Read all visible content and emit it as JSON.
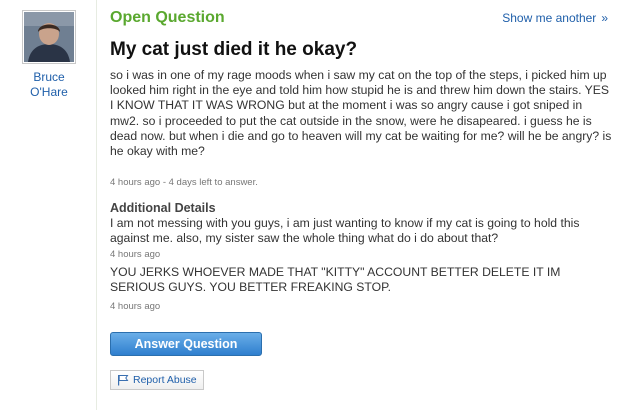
{
  "user": {
    "name_line1": "Bruce",
    "name_line2": "O'Hare"
  },
  "header": {
    "status": "Open Question",
    "show_another": "Show me another",
    "show_another_chevron": "»"
  },
  "question": {
    "title": "My cat just died it he okay?",
    "body": "so i was in one of my rage moods when i saw my cat on the top of the steps, i picked him up looked him right in the eye and told him how stupid he is and threw him down the stairs. YES I KNOW THAT IT WAS WRONG but at the moment i was so angry cause i got sniped in mw2. so i proceeded to put the cat outside in the snow, were he disapeared. i guess he is dead now. but when i die and go to heaven will my cat be waiting for me? will he be angry? is he okay with me?",
    "meta": "4 hours ago - 4 days left to answer."
  },
  "additional_details": {
    "heading": "Additional Details",
    "items": [
      {
        "text": "I am not messing with you guys, i am just wanting to know if my cat is going to hold this against me. also, my sister saw the whole thing what do i do about that?",
        "time": "4 hours ago"
      },
      {
        "text": "YOU JERKS WHOEVER MADE THAT \"KITTY\" ACCOUNT BETTER DELETE IT IM SERIOUS GUYS. YOU BETTER FREAKING STOP.",
        "time": "4 hours ago"
      }
    ]
  },
  "actions": {
    "answer_label": "Answer Question",
    "report_label": "Report Abuse"
  },
  "icons": {
    "report": "flag-icon"
  },
  "colors": {
    "status_green": "#5aa82f",
    "link_blue": "#1f5faa",
    "button_blue": "#2f7fce"
  }
}
